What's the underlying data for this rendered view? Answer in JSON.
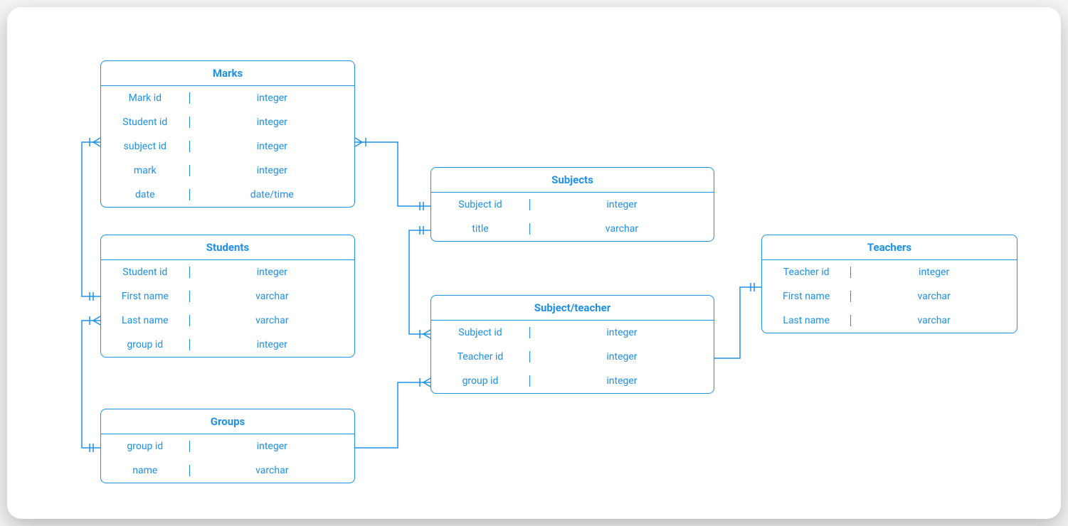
{
  "colors": {
    "accent": "#1e90e6"
  },
  "entities": {
    "marks": {
      "title": "Marks",
      "rows": [
        {
          "name": "Mark id",
          "type": "integer"
        },
        {
          "name": "Student id",
          "type": "integer"
        },
        {
          "name": "subject id",
          "type": "integer"
        },
        {
          "name": "mark",
          "type": "integer"
        },
        {
          "name": "date",
          "type": "date/time"
        }
      ]
    },
    "students": {
      "title": "Students",
      "rows": [
        {
          "name": "Student id",
          "type": "integer"
        },
        {
          "name": "First name",
          "type": "varchar"
        },
        {
          "name": "Last name",
          "type": "varchar"
        },
        {
          "name": "group id",
          "type": "integer"
        }
      ]
    },
    "groups": {
      "title": "Groups",
      "rows": [
        {
          "name": "group id",
          "type": "integer"
        },
        {
          "name": "name",
          "type": "varchar"
        }
      ]
    },
    "subjects": {
      "title": "Subjects",
      "rows": [
        {
          "name": "Subject id",
          "type": "integer"
        },
        {
          "name": "title",
          "type": "varchar"
        }
      ]
    },
    "subject_teacher": {
      "title": "Subject/teacher",
      "rows": [
        {
          "name": "Subject id",
          "type": "integer"
        },
        {
          "name": "Teacher id",
          "type": "integer"
        },
        {
          "name": "group id",
          "type": "integer"
        }
      ]
    },
    "teachers": {
      "title": "Teachers",
      "rows": [
        {
          "name": "Teacher id",
          "type": "integer"
        },
        {
          "name": "First name",
          "type": "varchar"
        },
        {
          "name": "Last name",
          "type": "varchar"
        }
      ]
    }
  },
  "relationships": [
    {
      "from": "marks.subject_id",
      "to": "subjects.subject_id",
      "card_from": "many",
      "card_to": "one"
    },
    {
      "from": "marks.student_id",
      "to": "students.student_id",
      "card_from": "many",
      "card_to": "one"
    },
    {
      "from": "students.group_id",
      "to": "groups.group_id",
      "card_from": "many",
      "card_to": "one"
    },
    {
      "from": "groups.group_id",
      "to": "subject_teacher.group_id",
      "card_from": "one",
      "card_to": "many"
    },
    {
      "from": "subjects.subject_id",
      "to": "subject_teacher.subject_id",
      "card_from": "one",
      "card_to": "many"
    },
    {
      "from": "subject_teacher.teacher_id",
      "to": "teachers.teacher_id",
      "card_from": "many",
      "card_to": "one"
    }
  ]
}
